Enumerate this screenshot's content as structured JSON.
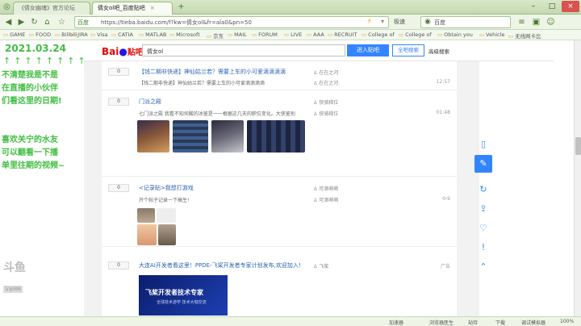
{
  "browser": {
    "tabs": [
      {
        "label": "《倩女幽魂》官方论坛"
      },
      {
        "label": "倩女ol吧_百度贴吧"
      }
    ],
    "url_tag": "百度",
    "url": "https://tieba.baidu.com/f?kw=倩女ol&fr=ala0&pn=50",
    "speed_label": "极速",
    "search_engine": "百度",
    "bookmarks": [
      "GAME",
      "FOOD",
      "Bilibili",
      "JIRA",
      "Visa",
      "CATIA",
      "MATLAB",
      "Microsoft",
      "京东",
      "MAIL",
      "FORUM",
      "LIVE",
      "AAA",
      "RECRUIT",
      "College of",
      "College of",
      "Obtain you",
      "Vehicle",
      "无线网卡比"
    ]
  },
  "overlay": {
    "date": "2021.03.24",
    "arrows": "↑↑↑↑↑↑↑↑",
    "lines1": [
      "不清楚我是不是",
      "在直播的小伙伴",
      "们看这里的日期!"
    ],
    "lines2": [
      "喜欢关宁的水友",
      "可以翻看一下播",
      "单里往期的视频~"
    ],
    "watermark": "斗鱼",
    "watermark_sub": "写给网明"
  },
  "tieba": {
    "logo_bai": "Bai",
    "logo_du": "du",
    "logo_tb": "贴吧",
    "search_value": "倩女ol",
    "enter_button": "进入贴吧",
    "all_search_button": "全吧搜索",
    "advanced_link": "高级搜索"
  },
  "posts": [
    {
      "count": "0",
      "title": "【钱二期非快递】神仙姑兰若？需要上车的小可爱滴滴滴滴",
      "snippet": "【钱二期非快递】神仙姑兰若？需要上车的小可爱滴滴滴滴",
      "author": "在在之河",
      "author2": "在在之河",
      "time": "12:57"
    },
    {
      "count": "0",
      "title": "门派之殿",
      "snippet": "七门派之殿 我看不知何酸的冰鉴是一一根据这几天的职位变化。大侠鉴别",
      "author": "侠骑梯位",
      "author2": "侠骑梯位",
      "time": "01:48"
    },
    {
      "count": "0",
      "title": "<记录贴>我想打游戏",
      "snippet": "开个帖子记录一下搞生!",
      "author": "可滴萌萌",
      "author2": "可滴萌萌",
      "time": "0-9"
    },
    {
      "count": "0",
      "title": "大连AI开发者看这里！PPDE-飞桨开发者专家计划发布,欢迎加入！",
      "snippet": "",
      "author": "飞桨",
      "author2": "",
      "time": "广告"
    }
  ],
  "ad_banner": {
    "title": "飞桨开发者技术专家",
    "subtitle": "全球技术游学  技术大咖交流"
  },
  "status": [
    "加速器",
    "浏览器医生",
    "劫持",
    "下载",
    "调试模拟器",
    "100%"
  ],
  "colors": {
    "tieba_blue": "#3385ff",
    "overlay_green": "#3fbf3f",
    "chrome_green": "#c4d9b0"
  }
}
